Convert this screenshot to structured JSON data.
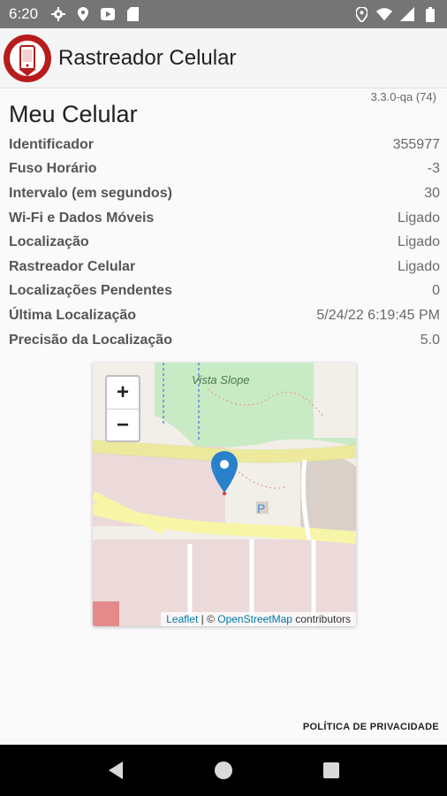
{
  "status_bar": {
    "time": "6:20",
    "left_icons": [
      "settings-icon",
      "location-icon",
      "play-icon",
      "sd-card-icon"
    ],
    "right_icons": [
      "location-icon",
      "wifi-icon",
      "signal-icon",
      "battery-icon"
    ]
  },
  "app_bar": {
    "title": "Rastreador Celular",
    "logo_icon": "phone-logo-icon",
    "logo_color": "#b71c1c"
  },
  "version": "3.3.0-qa (74)",
  "page_title": "Meu Celular",
  "info": [
    {
      "label": "Identificador",
      "value": "355977"
    },
    {
      "label": "Fuso Horário",
      "value": "-3"
    },
    {
      "label": "Intervalo (em segundos)",
      "value": "30"
    },
    {
      "label": "Wi-Fi e Dados Móveis",
      "value": "Ligado"
    },
    {
      "label": "Localização",
      "value": "Ligado"
    },
    {
      "label": "Rastreador Celular",
      "value": "Ligado"
    },
    {
      "label": "Localizações Pendentes",
      "value": "0"
    },
    {
      "label": "Última Localização",
      "value": "5/24/22 6:19:45 PM"
    },
    {
      "label": "Precisão da Localização",
      "value": "5.0"
    }
  ],
  "map": {
    "zoom_in": "+",
    "zoom_out": "−",
    "place_label": "Vista Slope",
    "attribution_leaflet": "Leaflet",
    "attribution_sep": " | © ",
    "attribution_osm": "OpenStreetMap",
    "attribution_suffix": " contributors",
    "marker_color": "#2a81cb"
  },
  "privacy_link": "POLÍTICA DE PRIVACIDADE",
  "nav_bar": {
    "buttons": [
      "back-icon",
      "home-icon",
      "recents-icon"
    ]
  }
}
